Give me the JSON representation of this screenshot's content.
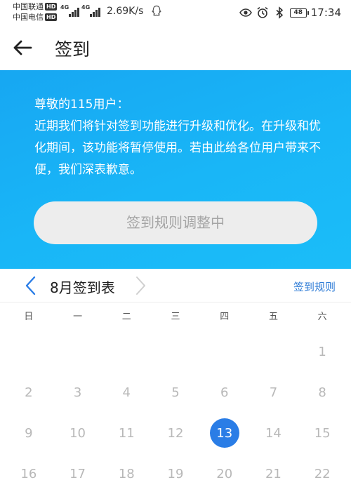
{
  "status_bar": {
    "carrier_1": "中国联通",
    "carrier_2": "中国电信",
    "hd_badge": "HD",
    "network_type_1": "4G",
    "network_type_2": "4G",
    "net_speed": "2.69K/s",
    "battery": "48",
    "time": "17:34"
  },
  "nav": {
    "title": "签到"
  },
  "notice": {
    "greeting": "尊敬的115用户：",
    "body": "近期我们将针对签到功能进行升级和优化。在升级和优化期间，该功能将暂停使用。若由此给各位用户带来不便，我们深表歉意。",
    "button_label": "签到规则调整中"
  },
  "calendar": {
    "month_title": "8月签到表",
    "rules_link": "签到规则",
    "weekdays": [
      "日",
      "一",
      "二",
      "三",
      "四",
      "五",
      "六"
    ],
    "days": [
      "1",
      "2",
      "3",
      "4",
      "5",
      "6",
      "7",
      "8",
      "9",
      "10",
      "11",
      "12",
      "13",
      "14",
      "15",
      "16",
      "17",
      "18",
      "19",
      "20",
      "21",
      "22"
    ],
    "today": "13",
    "accent_color": "#2a7de6"
  },
  "colors": {
    "banner": "#19b6f7",
    "link": "#2d7bd6"
  }
}
